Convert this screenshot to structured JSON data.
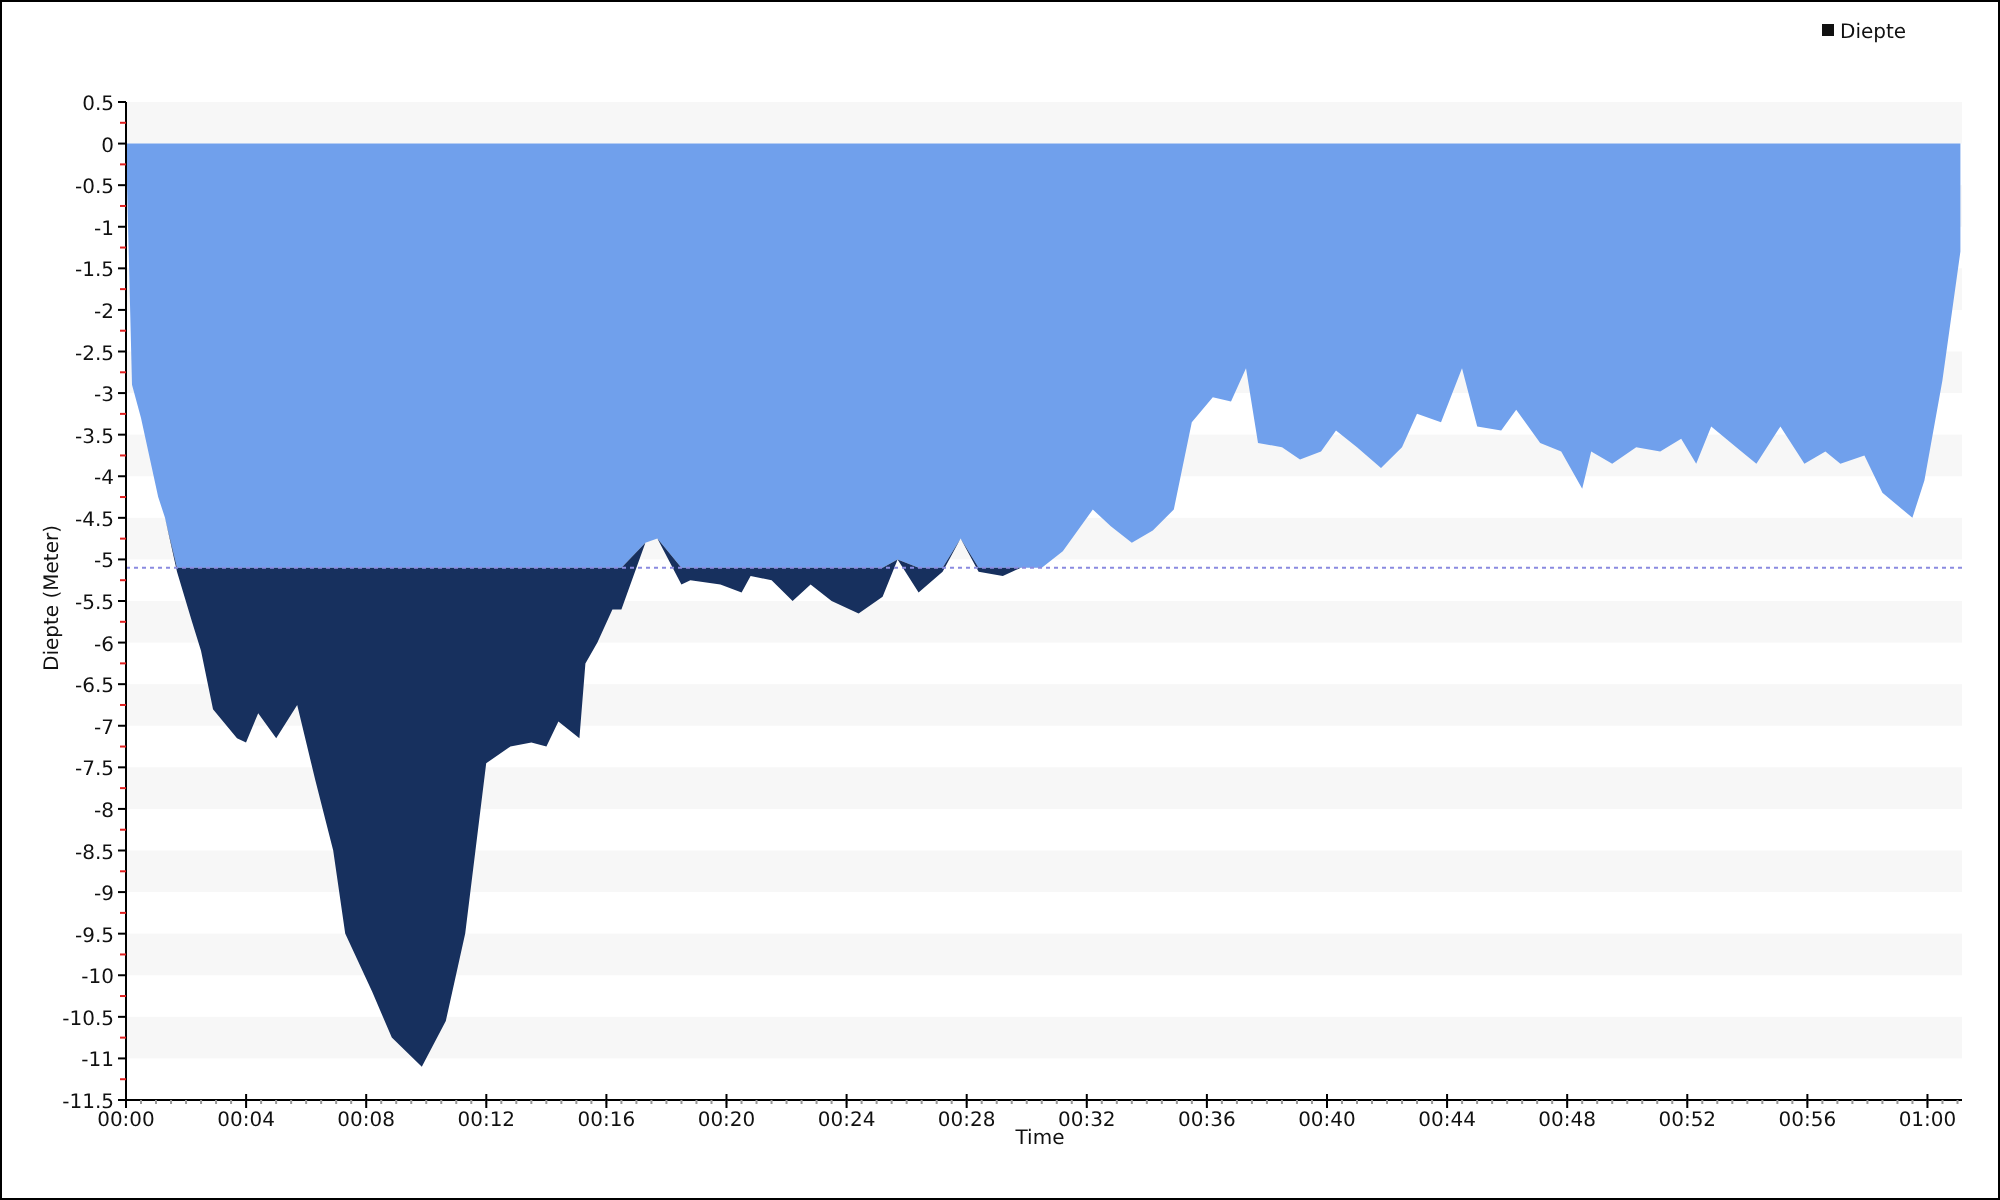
{
  "chart_data": {
    "type": "area",
    "xlabel": "Time",
    "ylabel": "Diepte (Meter)",
    "xlim": [
      0,
      61.15
    ],
    "ylim": [
      -11.5,
      0.5
    ],
    "stacked": true,
    "x": [
      0,
      0.2,
      0.5,
      1.07,
      1.3,
      1.7,
      2.2,
      2.5,
      2.9,
      3.7,
      4.0,
      4.4,
      5.0,
      5.7,
      6.3,
      6.9,
      7.3,
      8.2,
      8.85,
      9.85,
      10.65,
      11.3,
      12.0,
      12.8,
      13.5,
      14.0,
      14.4,
      15.1,
      15.3,
      15.7,
      16.2,
      16.5,
      17.3,
      17.7,
      18.5,
      18.8,
      19.8,
      20.5,
      20.8,
      21.5,
      22.2,
      22.8,
      23.5,
      24.4,
      25.2,
      25.7,
      26.4,
      27.2,
      27.8,
      28.4,
      29.2,
      29.8,
      30.5,
      31.2,
      32.2,
      32.8,
      33.5,
      34.2,
      34.9,
      35.5,
      36.2,
      36.8,
      37.3,
      37.7,
      38.5,
      39.1,
      39.8,
      40.3,
      41.0,
      41.8,
      42.5,
      43.0,
      43.8,
      44.5,
      45.0,
      45.8,
      46.3,
      47.1,
      47.8,
      48.5,
      48.8,
      49.5,
      50.3,
      51.1,
      51.8,
      52.3,
      52.8,
      53.8,
      54.3,
      55.1,
      55.9,
      56.6,
      57.1,
      57.9,
      58.5,
      59.5,
      59.9,
      60.5,
      61.1
    ],
    "series": [
      {
        "name": "Diepte",
        "color": "#70a0ec",
        "values": [
          0,
          -2.9,
          -3.3,
          -4.25,
          -4.5,
          -5.1,
          -5.1,
          -5.1,
          -5.1,
          -5.1,
          -5.1,
          -5.1,
          -5.1,
          -5.1,
          -5.1,
          -5.1,
          -5.1,
          -5.1,
          -5.1,
          -5.1,
          -5.1,
          -5.1,
          -5.1,
          -5.1,
          -5.1,
          -5.1,
          -5.1,
          -5.1,
          -5.1,
          -5.1,
          -5.1,
          -5.1,
          -4.8,
          -4.75,
          -5.1,
          -5.1,
          -5.1,
          -5.1,
          -5.1,
          -5.1,
          -5.1,
          -5.1,
          -5.1,
          -5.1,
          -5.1,
          -5.0,
          -5.1,
          -5.1,
          -4.75,
          -5.1,
          -5.1,
          -5.1,
          -5.1,
          -4.9,
          -4.4,
          -4.6,
          -4.8,
          -4.65,
          -4.4,
          -3.35,
          -3.05,
          -3.1,
          -2.7,
          -3.6,
          -3.65,
          -3.8,
          -3.7,
          -3.45,
          -3.65,
          -3.9,
          -3.65,
          -3.25,
          -3.35,
          -2.7,
          -3.4,
          -3.45,
          -3.2,
          -3.6,
          -3.7,
          -4.15,
          -3.7,
          -3.85,
          -3.65,
          -3.7,
          -3.55,
          -3.85,
          -3.4,
          -3.7,
          -3.85,
          -3.4,
          -3.85,
          -3.7,
          -3.85,
          -3.75,
          -4.2,
          -4.5,
          -4.05,
          -2.85,
          -1.3
        ]
      },
      {
        "color": "#17305e",
        "values": [
          0,
          0,
          0,
          0,
          0,
          -0.05,
          -0.65,
          -1,
          -1.7,
          -2.05,
          -2.1,
          -1.75,
          -2.05,
          -1.65,
          -2.55,
          -3.4,
          -4.4,
          -5.1,
          -5.65,
          -6,
          -5.45,
          -4.4,
          -2.35,
          -2.15,
          -2.1,
          -2.15,
          -1.85,
          -2.05,
          -1.15,
          -0.9,
          -0.5,
          -0.5,
          0,
          0,
          -0.2,
          -0.15,
          -0.2,
          -0.3,
          -0.1,
          -0.15,
          -0.4,
          -0.2,
          -0.4,
          -0.55,
          -0.35,
          0,
          -0.3,
          -0.05,
          0,
          -0.05,
          -0.1,
          0,
          0,
          0,
          0,
          0,
          0,
          0,
          0,
          0,
          0,
          0,
          0,
          0,
          0,
          0,
          0,
          0,
          0,
          0,
          0,
          0,
          0,
          0,
          0,
          0,
          0,
          0,
          0,
          0,
          0,
          0,
          0,
          0,
          0,
          0,
          0,
          0,
          0,
          0,
          0,
          0,
          0,
          0,
          0,
          0,
          0,
          0,
          0
        ]
      }
    ],
    "xticks": [
      {
        "value": 0,
        "label": "00:00"
      },
      {
        "value": 4,
        "label": "00:04"
      },
      {
        "value": 8,
        "label": "00:08"
      },
      {
        "value": 12,
        "label": "00:12"
      },
      {
        "value": 16,
        "label": "00:16"
      },
      {
        "value": 20,
        "label": "00:20"
      },
      {
        "value": 24,
        "label": "00:24"
      },
      {
        "value": 28,
        "label": "00:28"
      },
      {
        "value": 32,
        "label": "00:32"
      },
      {
        "value": 36,
        "label": "00:36"
      },
      {
        "value": 40,
        "label": "00:40"
      },
      {
        "value": 44,
        "label": "00:44"
      },
      {
        "value": 48,
        "label": "00:48"
      },
      {
        "value": 52,
        "label": "00:52"
      },
      {
        "value": 56,
        "label": "00:56"
      },
      {
        "value": 60,
        "label": "01:00"
      }
    ],
    "ref_lines": [
      {
        "axis": "y",
        "value": -5.1,
        "color": "#8a8ae0"
      }
    ],
    "yticks": [
      0.5,
      0,
      -0.5,
      -1,
      -1.5,
      -2,
      -2.5,
      -3,
      -3.5,
      -4,
      -4.5,
      -5,
      -5.5,
      -6,
      -6.5,
      -7,
      -7.5,
      -8,
      -8.5,
      -9,
      -9.5,
      -10,
      -10.5,
      -11,
      -11.5
    ]
  }
}
